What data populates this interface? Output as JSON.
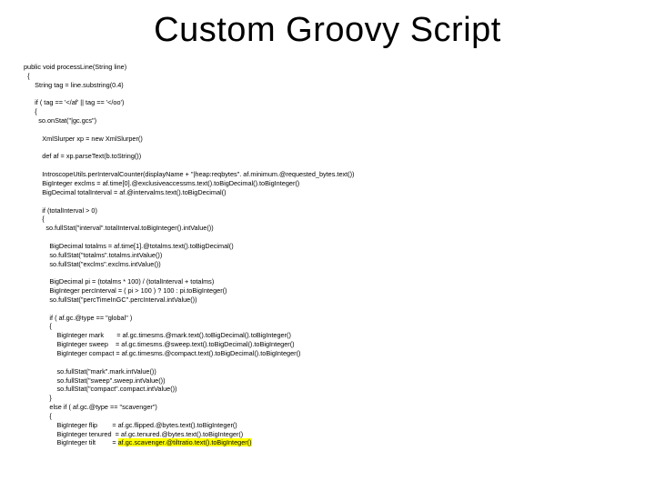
{
  "title": "Custom Groovy Script",
  "code": {
    "l1": "public void processLine(String line)",
    "l2": "{",
    "l3": "    String tag = line.substring(0.4)",
    "l4": "",
    "l5": "    if ( tag == '</af' || tag == '</oo')",
    "l6": "    {",
    "l7": "      so.onStat(\"|gc.gcs\")",
    "l8": "",
    "l9": "      XmlSlurper xp = new XmlSlurper()",
    "l10": "",
    "l11": "      def af = xp.parseText(b.toString())",
    "l12": "",
    "l13": "      IntroscopeUtils.perIntervalCounter(displayName + \"|heap:reqbytes\". af.minimum.@requested_bytes.text())",
    "l14": "      BigInteger exclms = af.time[0].@exclusiveaccessms.text().toBigDecimal().toBigInteger()",
    "l15": "      BigDecimal totalInterval = af.@intervalms.text().toBigDecimal()",
    "l16": "",
    "l17": "      if (totalInterval > 0)",
    "l18": "      {",
    "l19": "        so.fullStat(\"interval\".totalInterval.toBigInteger().intValue())",
    "l20": "",
    "l21": "        BigDecimal totalms = af.time[1].@totalms.text().toBigDecimal()",
    "l22": "        so.fullStat(\"totalms\".totalms.intValue())",
    "l23": "        so.fullStat(\"exclms\".exclms.intValue())",
    "l24": "",
    "l25": "        BigDecimal pi = (totalms * 100) / (totalInterval + totalms)",
    "l26": "        BigInteger percInterval = ( pi > 100 ) ? 100 : pi.toBigInteger()",
    "l27": "        so.fullStat(\"percTimeInGC\".percInterval.intValue())",
    "l28": "",
    "l29": "        if ( af.gc.@type == \"global\" )",
    "l30": "        {",
    "l31": "            BigInteger mark       = af.gc.timesms.@mark.text().toBigDecimal().toBigInteger()",
    "l32": "            BigInteger sweep    = af.gc.timesms.@sweep.text().toBigDecimal().toBigInteger()",
    "l33": "            BigInteger compact = af.gc.timesms.@compact.text().toBigDecimal().toBigInteger()",
    "l34": "",
    "l35": "            so.fullStat(\"mark\".mark.intValue())",
    "l36": "            so.fullStat(\"sweep\".sweep.intValue())",
    "l37": "            so.fullStat(\"compact\".compact.intValue())",
    "l38": "        }",
    "l39": "        else if ( af.gc.@type == \"scavenger\")",
    "l40": "        {",
    "l41": "            BigInteger flip        = af.gc.flipped.@bytes.text().toBigInteger()",
    "l42": "            BigInteger tenured  = af.gc.tenured.@bytes.text().toBigInteger()",
    "l43a": "            BigInteger tilt         = ",
    "l43b": "af.gc.scavenger.@tiltratio.text().toBigInteger()"
  }
}
